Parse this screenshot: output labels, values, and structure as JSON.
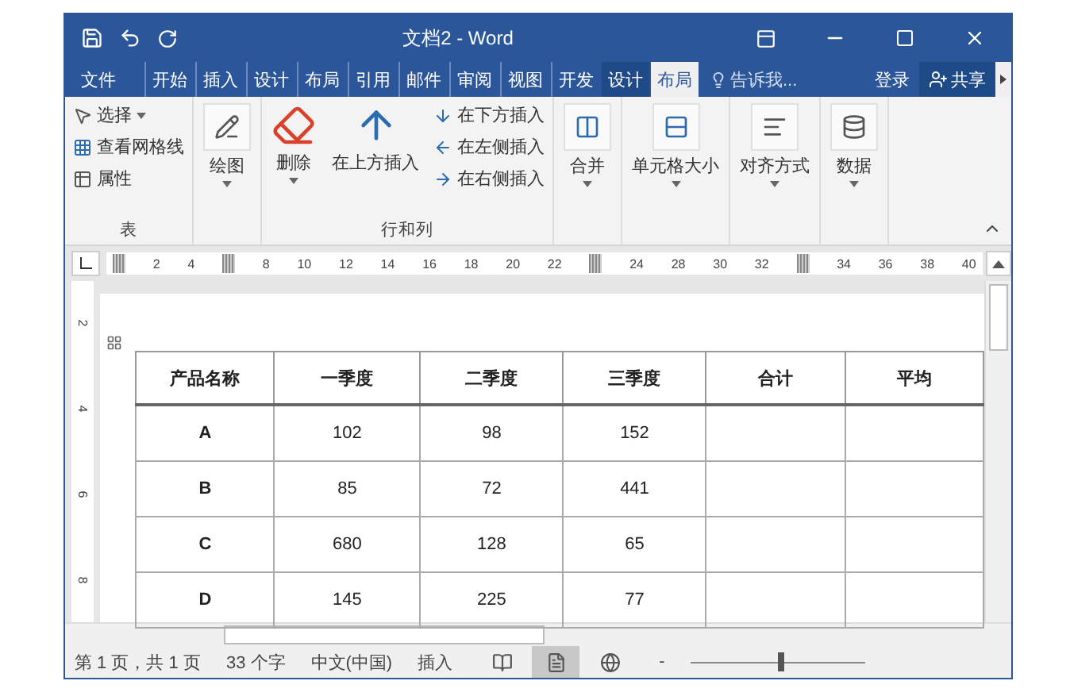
{
  "window": {
    "title": "文档2 - Word"
  },
  "tabs": [
    {
      "label": "文件",
      "kind": "file",
      "selected": false
    },
    {
      "label": "开始",
      "kind": "normal",
      "selected": false
    },
    {
      "label": "插入",
      "kind": "normal",
      "selected": false
    },
    {
      "label": "设计",
      "kind": "normal",
      "selected": false
    },
    {
      "label": "布局",
      "kind": "normal",
      "selected": false
    },
    {
      "label": "引用",
      "kind": "normal",
      "selected": false
    },
    {
      "label": "邮件",
      "kind": "normal",
      "selected": false
    },
    {
      "label": "审阅",
      "kind": "normal",
      "selected": false
    },
    {
      "label": "视图",
      "kind": "normal",
      "selected": false
    },
    {
      "label": "开发",
      "kind": "normal",
      "selected": false
    },
    {
      "label": "设计",
      "kind": "contextual",
      "selected": false
    },
    {
      "label": "布局",
      "kind": "contextual",
      "selected": true
    }
  ],
  "tell_me": {
    "placeholder": "告诉我..."
  },
  "sign_in": "登录",
  "share": "共享",
  "ribbon": {
    "table_group": {
      "label": "表",
      "items": [
        {
          "label": "选择",
          "kind": "select"
        },
        {
          "label": "查看网格线",
          "kind": "gridlines"
        },
        {
          "label": "属性",
          "kind": "properties"
        }
      ]
    },
    "draw": {
      "label": "绘图"
    },
    "rows_cols": {
      "label": "行和列",
      "delete": "删除",
      "insert_above": "在上方插入",
      "small": [
        {
          "label": "在下方插入",
          "kind": "below"
        },
        {
          "label": "在左侧插入",
          "kind": "left"
        },
        {
          "label": "在右侧插入",
          "kind": "right"
        }
      ]
    },
    "big_buttons": [
      {
        "label": "合并",
        "kind": "merge"
      },
      {
        "label": "单元格大小",
        "kind": "size"
      },
      {
        "label": "对齐方式",
        "kind": "align"
      },
      {
        "label": "数据",
        "kind": "data"
      }
    ]
  },
  "ruler": [
    "2",
    "4",
    "8",
    "10",
    "12",
    "14",
    "16",
    "18",
    "20",
    "22",
    "24",
    "28",
    "30",
    "32",
    "34",
    "36",
    "38",
    "40"
  ],
  "vertical_ruler": [
    "2",
    "4",
    "6",
    "8"
  ],
  "table": {
    "columns": [
      "产品名称",
      "一季度",
      "二季度",
      "三季度",
      "合计",
      "平均"
    ],
    "rows": [
      [
        "A",
        "102",
        "98",
        "152",
        "",
        ""
      ],
      [
        "B",
        "85",
        "72",
        "441",
        "",
        ""
      ],
      [
        "C",
        "680",
        "128",
        "65",
        "",
        ""
      ],
      [
        "D",
        "145",
        "225",
        "77",
        "",
        ""
      ]
    ]
  },
  "status_bar": {
    "page": "第 1 页，共 1 页",
    "words": "33 个字",
    "language": "中文(中国)",
    "mode": "插入",
    "views": [
      {
        "kind": "read",
        "selected": false
      },
      {
        "kind": "print",
        "selected": true
      },
      {
        "kind": "web",
        "selected": false
      }
    ],
    "zoom_minus": "-",
    "zoom": {
      "level": 0.5
    }
  }
}
